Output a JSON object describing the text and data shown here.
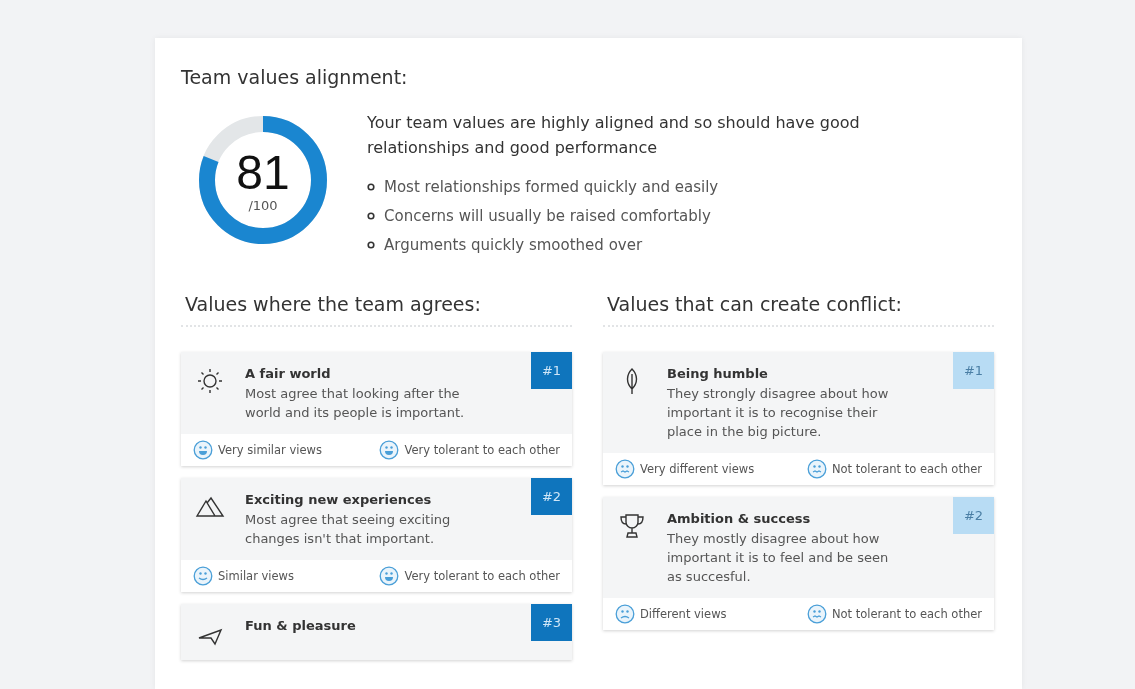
{
  "title": "Team values alignment:",
  "score": {
    "value": "81",
    "max": "/100",
    "level": 0.81
  },
  "summary": {
    "headline": "Your team values are highly aligned and so should have good relationships and good performance",
    "points": [
      "Most relationships formed quickly and easily",
      "Concerns will usually be raised comfortably",
      "Arguments quickly smoothed over"
    ]
  },
  "sections": [
    {
      "heading": "Values where the team agrees:",
      "kind": "agree",
      "cards": [
        {
          "title": "A fair world",
          "text": "Most agree that looking after the world and its people is important.",
          "rank": "#1",
          "indicators": [
            {
              "label": "Very similar views",
              "kind": "happy"
            },
            {
              "label": "Very tolerant to each other",
              "kind": "happy"
            }
          ]
        },
        {
          "title": "Exciting new experiences",
          "text": "Most agree that seeing exciting changes isn't that important.",
          "rank": "#2",
          "indicators": [
            {
              "label": "Similar views",
              "kind": "smile"
            },
            {
              "label": "Very tolerant to each other",
              "kind": "happy"
            }
          ]
        },
        {
          "title": "Fun & pleasure",
          "rank": "#3"
        }
      ]
    },
    {
      "heading": "Values that can create conflict:",
      "kind": "conflict",
      "cards": [
        {
          "title": "Being humble",
          "text": "They strongly disagree about how important it is to recognise their place in the big picture.",
          "rank": "#1",
          "indicators": [
            {
              "label": "Very different views",
              "kind": "upset"
            },
            {
              "label": "Not tolerant to each other",
              "kind": "upset"
            }
          ]
        },
        {
          "title": "Ambition & success",
          "text": "They mostly disagree about how important it is to feel and be seen as succesful.",
          "rank": "#2",
          "indicators": [
            {
              "label": "Different views",
              "kind": "sad"
            },
            {
              "label": "Not tolerant to each other",
              "kind": "upset"
            }
          ]
        }
      ]
    }
  ]
}
